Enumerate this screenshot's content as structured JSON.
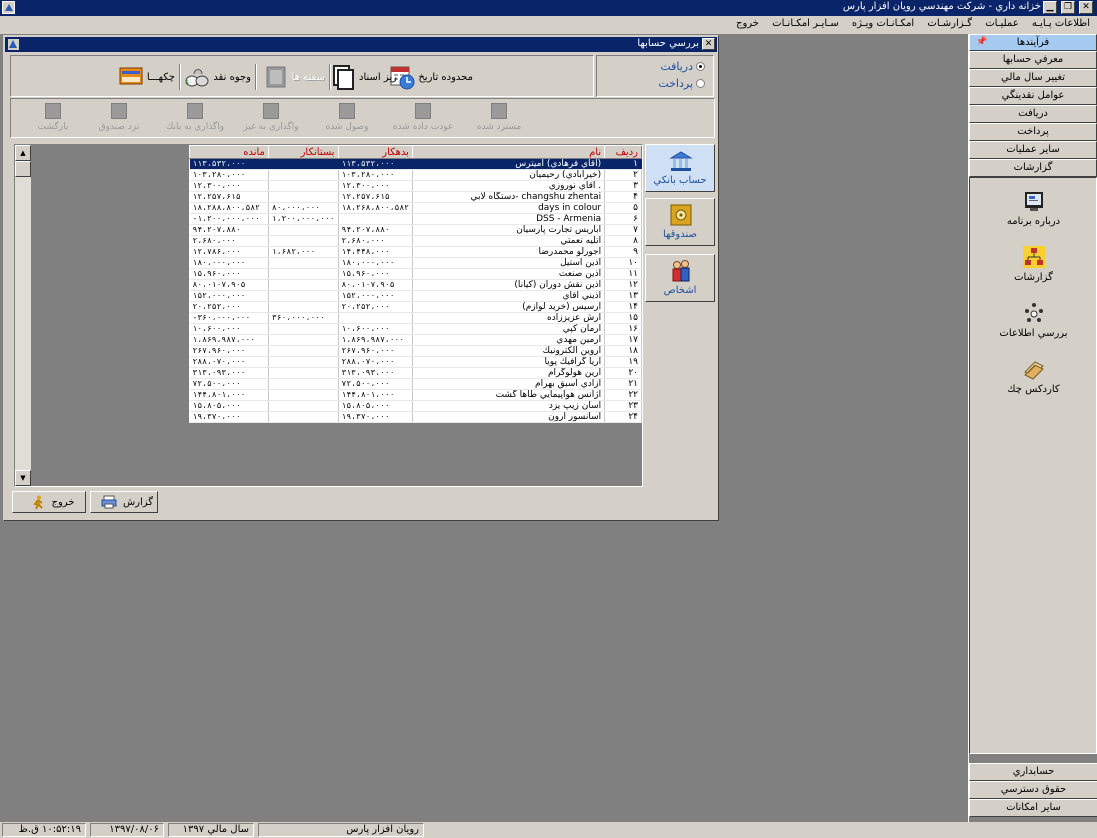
{
  "app": {
    "title": "خزانه داري - شركت مهندسي رويان افزار پارس"
  },
  "menu": [
    "اطلاعات پـايـه",
    "عمليـات",
    "گـزارشـات",
    "امكـانـات ويـژه",
    "سـايـر امكـانـات",
    "خروج"
  ],
  "sidebar": {
    "header": "فرآيندها",
    "items": [
      "معرفي حسابها",
      "تغيير سال مالي",
      "عوامل نقدينگي",
      "دريافت",
      "پرداخت",
      "ساير عمليات",
      "گزارشات"
    ],
    "icons": [
      {
        "label": "درباره برنامه",
        "icon": "about-icon"
      },
      {
        "label": "گزارشات",
        "icon": "reports-icon"
      },
      {
        "label": "بررسي اطلاعات",
        "icon": "inspect-icon"
      },
      {
        "label": "كاردكس چك",
        "icon": "cheque-kardex-icon"
      }
    ],
    "bottom": [
      "حسابداري",
      "حقوق دسترسي",
      "ساير امكانات"
    ]
  },
  "window": {
    "title": "بررسي حسابها",
    "radio": {
      "receive": "دريافت",
      "pay": "پرداخت"
    },
    "toolbar": {
      "date_range": "محدوده تاريخ",
      "doc_detail": "ريز اسناد",
      "page": "سفته ها",
      "cash": "وجوه نقد",
      "cheques": "چكهـــا"
    },
    "toolbar2": [
      "مسترد شده",
      "عودت داده شده",
      "وصول شده",
      "واگذاري به غير",
      "واگذاري به بانك",
      "نزد صندوق",
      "بازگشت"
    ],
    "side_buttons": [
      "حساب بانكي",
      "صندوقها",
      "اشخاص"
    ],
    "columns": [
      "رديف",
      "نام",
      "بدهكار",
      "بستانكار",
      "مانده"
    ],
    "rows": [
      [
        "۱",
        "(آقاي فرهادي) آميترس",
        "۱۱۳،۵۳۲،۰۰۰",
        "",
        "۱۱۳،۵۳۲،۰۰۰"
      ],
      [
        "۲",
        "(خيرآبادي) رحيميان",
        "۱۰۳،۲۸۰،۰۰۰",
        "",
        "۱۰۳،۲۸۰،۰۰۰"
      ],
      [
        "۳",
        ". آقاي نوروزي",
        "۱۲،۳۰۰،۰۰۰",
        "",
        "۱۲،۳۰۰،۰۰۰"
      ],
      [
        "۴",
        "changshu zhentai -دستگاه لابي",
        "۱۲،۲۵۷،۶۱۵",
        "",
        "۱۲،۲۵۷،۶۱۵"
      ],
      [
        "۵",
        "days in colour",
        "۱۸،۲۶۸،۸۰۰،۵۸۲",
        "۸۰،۰۰۰،۰۰۰",
        "۱۸،۲۸۸،۸۰۰،۵۸۲"
      ],
      [
        "۶",
        "DSS - Armenia",
        "",
        "۱،۲۰۰،۰۰۰،۰۰۰",
        "۱،۲۰۰،۰۰۰،۰۰۰-"
      ],
      [
        "۷",
        "آباريس تجارت پارسيان",
        "۹۴،۲۰۷،۸۸۰",
        "",
        "۹۴،۲۰۷،۸۸۰"
      ],
      [
        "۸",
        "آتليه نعمتي",
        "۲،۶۸۰،۰۰۰",
        "",
        "۲،۶۸۰،۰۰۰"
      ],
      [
        "۹",
        "آجورلو محمدرضا",
        "۱۴،۴۴۸،۰۰۰",
        "۱،۶۸۲،۰۰۰",
        "۱۲،۷۸۶،۰۰۰"
      ],
      [
        "۱۰",
        "آذين استيل",
        "۱۸۰،۰۰۰،۰۰۰",
        "",
        "۱۸۰،۰۰۰،۰۰۰"
      ],
      [
        "۱۱",
        "آذين صنعت",
        "۱۵،۹۶۰،۰۰۰",
        "",
        "۱۵،۹۶۰،۰۰۰"
      ],
      [
        "۱۲",
        "آذين نقش دوران (كيانا)",
        "۸۰،۰۱۰۷،۹۰۵",
        "",
        "۸۰،۰۱۰۷،۹۰۵"
      ],
      [
        "۱۳",
        "آذيني آقاي",
        "۱۵۲،۰۰۰،۰۰۰",
        "",
        "۱۵۲،۰۰۰،۰۰۰"
      ],
      [
        "۱۴",
        "آرسيس (خريد لوازم)",
        "۲۰،۲۵۲،۰۰۰",
        "",
        "۲۰،۲۵۲،۰۰۰"
      ],
      [
        "۱۵",
        "آرش عزيززاده",
        "",
        "۳۶۰،۰۰۰،۰۰۰",
        "۳۶۰،۰۰۰،۰۰۰-"
      ],
      [
        "۱۶",
        "آرمان كپي",
        "۱۰،۶۰۰،۰۰۰",
        "",
        "۱۰،۶۰۰،۰۰۰"
      ],
      [
        "۱۷",
        "آرمين مهدي",
        "۱،۸۶۹،۹۸۷،۰۰۰",
        "",
        "۱،۸۶۹،۹۸۷،۰۰۰"
      ],
      [
        "۱۸",
        "آروين الكترونيك",
        "۲۶۷،۹۶۰،۰۰۰",
        "",
        "۲۶۷،۹۶۰،۰۰۰"
      ],
      [
        "۱۹",
        "آريا گرافيك پويا",
        "۲۸۸،۰۷۰،۰۰۰",
        "",
        "۲۸۸،۰۷۰،۰۰۰"
      ],
      [
        "۲۰",
        "آرين هولوگرام",
        "۳۱۳،۰۹۳،۰۰۰",
        "",
        "۳۱۳،۰۹۳،۰۰۰"
      ],
      [
        "۲۱",
        "آزادي اسبق بهرام",
        "۷۲،۵۰۰،۰۰۰",
        "",
        "۷۲،۵۰۰،۰۰۰"
      ],
      [
        "۲۲",
        "آژانس هواپيمايي طاها گشت",
        "۱۴۴،۸۰۱،۰۰۰",
        "",
        "۱۴۴،۸۰۱،۰۰۰"
      ],
      [
        "۲۳",
        "آسان زيپ يزد",
        "۱۵،۸۰۵،۰۰۰",
        "",
        "۱۵،۸۰۵،۰۰۰"
      ],
      [
        "۲۴",
        "آسانسور آرون",
        "۱۹،۳۷۰،۰۰۰",
        "",
        "۱۹،۳۷۰،۰۰۰"
      ]
    ],
    "buttons": {
      "report": "گزارش",
      "exit": "خروج"
    }
  },
  "status": {
    "time": "۱۰:۵۲:۱۹ ق.ظ",
    "date": "۱۳۹۷/۰۸/۰۶",
    "year": "سال مالي ۱۳۹۷",
    "company": "رويان افزار پارس"
  }
}
